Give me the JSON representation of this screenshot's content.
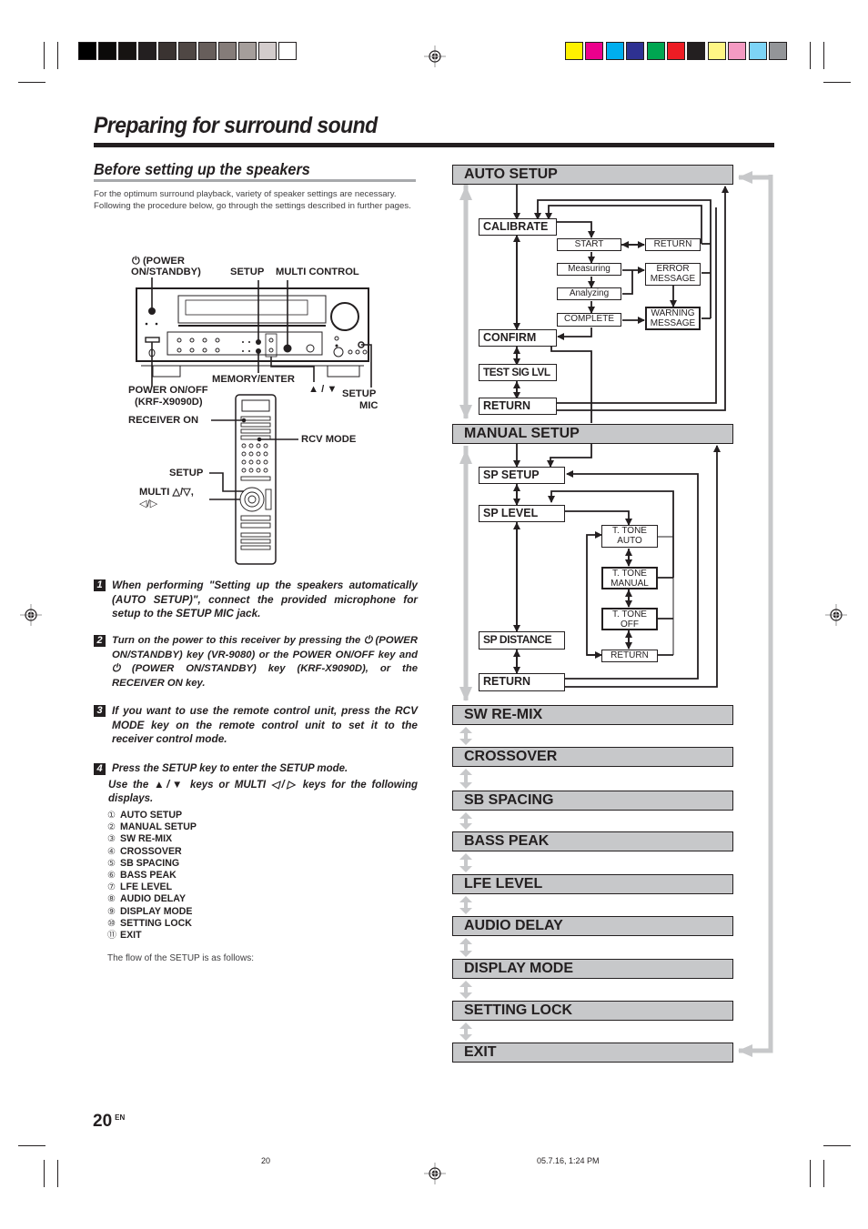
{
  "print_marks": {
    "gray_swatches": [
      "#000000",
      "#0b0a09",
      "#161312",
      "#231f20",
      "#3a3331",
      "#4f4744",
      "#675e5b",
      "#857c79",
      "#a59e9b",
      "#d3cccc",
      "#ffffff"
    ],
    "color_swatches": [
      "#fff200",
      "#ec008c",
      "#00aeef",
      "#2e3192",
      "#00a651",
      "#ed1c24",
      "#231f20",
      "#fff685",
      "#f49ac2",
      "#7dd4f6",
      "#939598"
    ]
  },
  "page": {
    "title": "Preparing for surround sound",
    "section_title": "Before setting up the speakers",
    "intro_line1": "For the optimum surround playback, variety of speaker settings are necessary.",
    "intro_line2": "Following the procedure below, go through the settings described in further pages."
  },
  "diagram": {
    "power_standby": "⏻ (POWER ON/STANDBY)",
    "power_standby_l1": "⏻ (POWER",
    "power_standby_l2": "ON/STANDBY)",
    "setup": "SETUP",
    "multi_control": "MULTI CONTROL",
    "memory_enter": "MEMORY/ENTER",
    "up_down": "▲ / ▼",
    "power_onoff_l1": "POWER ON/OFF",
    "power_onoff_l2": "(KRF-X9090D)",
    "setup_mic_l1": "SETUP",
    "setup_mic_l2": "MIC",
    "receiver_on": "RECEIVER ON",
    "rcv_mode": "RCV MODE",
    "remote_setup": "SETUP",
    "multi_l1": "MULTI △/▽,",
    "multi_l2": "◁/▷"
  },
  "steps": [
    {
      "num": "1",
      "text": "When performing \"Setting up the speakers automatically (AUTO SETUP)\", connect the provided microphone for setup to the SETUP MIC jack."
    },
    {
      "num": "2",
      "text": "Turn on the power to this receiver by pressing the ⏻ (POWER ON/STANDBY) key (VR-9080) or the POWER ON/OFF key and ⏻ (POWER ON/STANDBY) key (KRF-X9090D), or the RECEIVER ON key."
    },
    {
      "num": "3",
      "text": "If you want to use the remote control unit, press the RCV MODE key on the remote control unit to set it to the receiver control mode."
    },
    {
      "num": "4",
      "text": "Press the SETUP  key to enter the SETUP mode.",
      "text2": "Use the ▲/▼ keys or MULTI ◁/▷ keys for the following displays."
    }
  ],
  "menu_items": [
    {
      "n": "①",
      "label": "AUTO SETUP"
    },
    {
      "n": "②",
      "label": "MANUAL SETUP"
    },
    {
      "n": "③",
      "label": "SW RE-MIX"
    },
    {
      "n": "④",
      "label": "CROSSOVER"
    },
    {
      "n": "⑤",
      "label": "SB SPACING"
    },
    {
      "n": "⑥",
      "label": "BASS PEAK"
    },
    {
      "n": "⑦",
      "label": "LFE LEVEL"
    },
    {
      "n": "⑧",
      "label": "AUDIO DELAY"
    },
    {
      "n": "⑨",
      "label": "DISPLAY MODE"
    },
    {
      "n": "⑩",
      "label": "SETTING LOCK"
    },
    {
      "n": "⑪",
      "label": "EXIT"
    }
  ],
  "flow_note": "The flow of the SETUP is as follows:",
  "flow": {
    "main": [
      "AUTO SETUP",
      "MANUAL SETUP",
      "SW RE-MIX",
      "CROSSOVER",
      "SB SPACING",
      "BASS PEAK",
      "LFE LEVEL",
      "AUDIO DELAY",
      "DISPLAY MODE",
      "SETTING LOCK",
      "EXIT"
    ],
    "auto": {
      "calibrate": "CALIBRATE",
      "start": "START",
      "return_small": "RETURN",
      "measuring": "Measuring",
      "error_l1": "ERROR",
      "error_l2": "MESSAGE",
      "analyzing": "Analyzing",
      "complete": "COMPLETE",
      "warning_l1": "WARNING",
      "warning_l2": "MESSAGE",
      "confirm": "CONFIRM",
      "test_sig": "TEST SIG LVL",
      "return": "RETURN"
    },
    "manual": {
      "sp_setup": "SP SETUP",
      "sp_level": "SP LEVEL",
      "tt_auto_l1": "T. TONE",
      "tt_auto_l2": "AUTO",
      "tt_manual_l1": "T. TONE",
      "tt_manual_l2": "MANUAL",
      "tt_off_l1": "T. TONE",
      "tt_off_l2": "OFF",
      "tt_return": "RETURN",
      "sp_distance": "SP DISTANCE",
      "return": "RETURN"
    }
  },
  "footer": {
    "page_number": "20",
    "lang": "EN",
    "slug_page": "20",
    "slug_date": "05.7.16, 1:24 PM"
  }
}
